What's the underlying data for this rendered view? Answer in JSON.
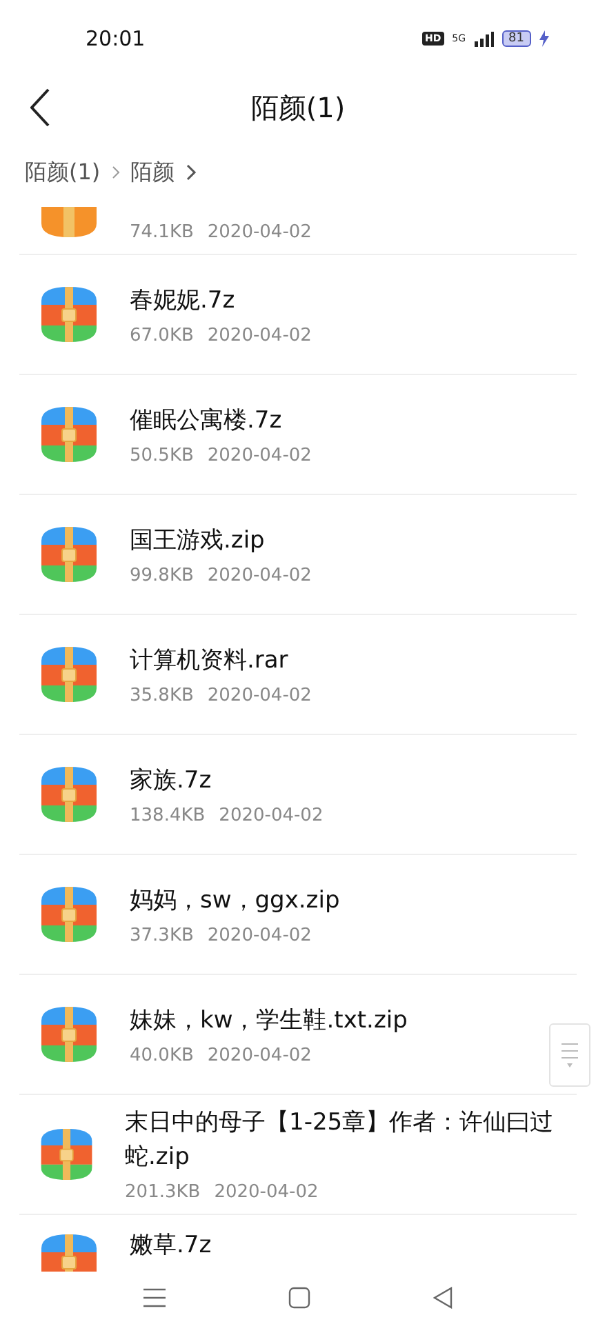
{
  "status_bar": {
    "time": "20:01",
    "hd": "HD",
    "network": "5G",
    "battery": "81",
    "charging": true
  },
  "header": {
    "title": "陌颜(1)"
  },
  "breadcrumbs": [
    {
      "label": "陌颜(1)"
    },
    {
      "label": "陌颜"
    }
  ],
  "files": [
    {
      "kind": "cut_top",
      "size": "74.1KB",
      "date": "2020-04-02"
    },
    {
      "kind": "file",
      "name": "春妮妮.7z",
      "size": "67.0KB",
      "date": "2020-04-02"
    },
    {
      "kind": "file",
      "name": "催眠公寓楼.7z",
      "size": "50.5KB",
      "date": "2020-04-02"
    },
    {
      "kind": "file",
      "name": "国王游戏.zip",
      "size": "99.8KB",
      "date": "2020-04-02"
    },
    {
      "kind": "file",
      "name": "计算机资料.rar",
      "size": "35.8KB",
      "date": "2020-04-02"
    },
    {
      "kind": "file",
      "name": "家族.7z",
      "size": "138.4KB",
      "date": "2020-04-02"
    },
    {
      "kind": "file",
      "name": "妈妈，sw，ggx.zip",
      "size": "37.3KB",
      "date": "2020-04-02"
    },
    {
      "kind": "file",
      "name": "妹妹，kw，学生鞋.txt.zip",
      "size": "40.0KB",
      "date": "2020-04-02"
    },
    {
      "kind": "file",
      "name": "末日中的母子【1-25章】作者：许仙曰过蛇.zip",
      "size": "201.3KB",
      "date": "2020-04-02"
    },
    {
      "kind": "cut_bottom",
      "name": "嫩草.7z"
    }
  ]
}
